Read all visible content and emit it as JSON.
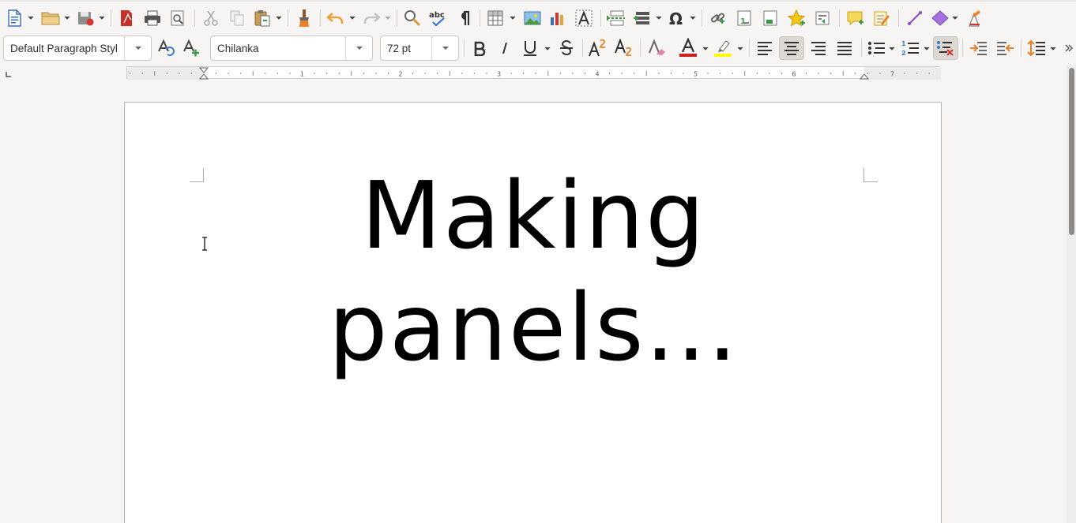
{
  "toolbar2": {
    "paragraph_style": "Default Paragraph Styl",
    "font_name": "Chilanka",
    "font_size": "72 pt"
  },
  "ruler": {
    "numbers": [
      "1",
      "2",
      "3",
      "4",
      "5",
      "6",
      "7"
    ]
  },
  "document": {
    "line1": "Making",
    "line2": "panels..."
  },
  "colors": {
    "font_color": "#c9211e",
    "highlight_color": "#ffff00",
    "toolbar_bg": "#f6f5f4"
  }
}
